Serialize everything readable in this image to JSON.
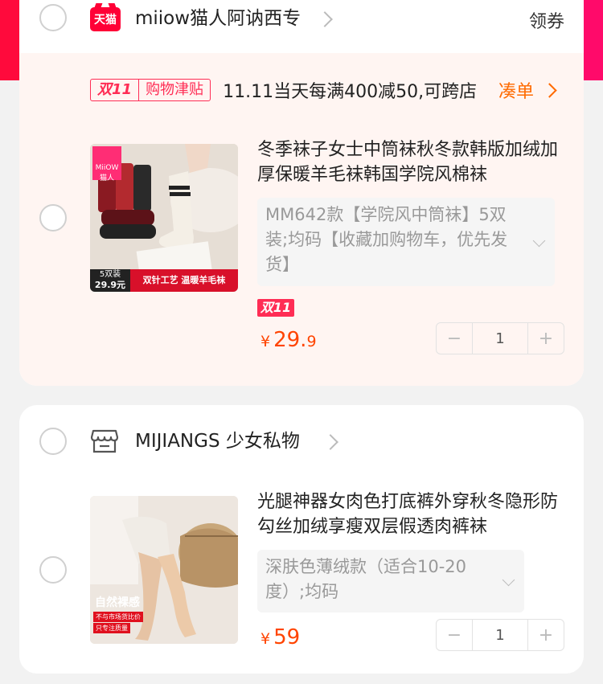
{
  "shops": [
    {
      "name": "miiow猫人阿讷西专",
      "platform_badge": "天猫",
      "coupon_label": "领券",
      "promo": {
        "badge_main": "双11",
        "badge_sub": "购物津贴",
        "text": "11.11当天每满400减50,可跨店",
        "action": "凑单"
      },
      "item": {
        "title": "冬季袜子女士中筒袜秋冬款韩版加绒加厚保暖羊毛袜韩国学院风棉袜",
        "sku": "MM642款【学院风中筒袜】5双装;均码【收藏加购物车，优先发货】",
        "tag": "双11",
        "price_currency": "¥",
        "price_int": "29.",
        "price_dec": "9",
        "quantity": "1",
        "thumb": {
          "brand": "MiiOW",
          "brand_sub": "猫人",
          "pack": "5双装",
          "pack_price": "29.9元",
          "slogan": "双针工艺 温暖羊毛袜"
        }
      }
    },
    {
      "name": "MIJIANGS 少女私物",
      "item": {
        "title": "光腿神器女肉色打底裤外穿秋冬隐形防勾丝加绒享瘦双层假透肉裤袜",
        "sku": "深肤色薄绒款（适合10-20度）;均码",
        "price_currency": "¥",
        "price_int": "59",
        "price_dec": "",
        "quantity": "1",
        "thumb": {
          "headline": "自然裸感",
          "line1": "不与市场货比价",
          "line2": "只专注质量"
        }
      }
    }
  ],
  "stepper": {
    "minus": "−",
    "plus": "+"
  },
  "colors": {
    "accent": "#ff4400",
    "tmall": "#ff0036",
    "promo": "#ff2d55",
    "action": "#ff6a00"
  }
}
